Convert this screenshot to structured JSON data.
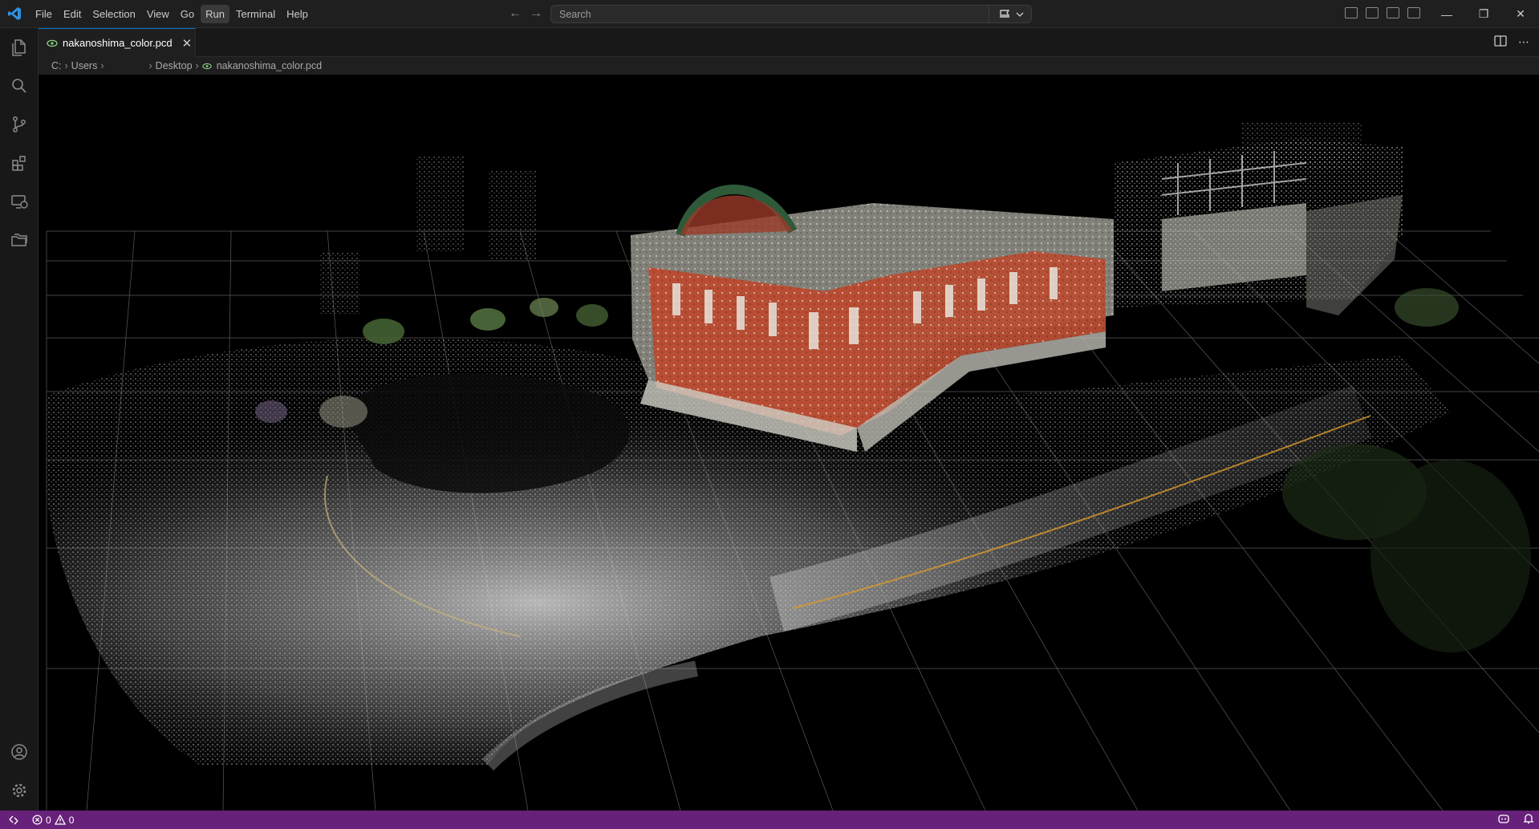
{
  "menu": [
    "File",
    "Edit",
    "Selection",
    "View",
    "Go",
    "Run",
    "Terminal",
    "Help"
  ],
  "search": {
    "placeholder": "Search"
  },
  "tab": {
    "filename": "nakanoshima_color.pcd"
  },
  "breadcrumb": {
    "drive": "C:",
    "users": "Users",
    "desktop": "Desktop",
    "file": "nakanoshima_color.pcd"
  },
  "status": {
    "errors": "0",
    "warnings": "0"
  },
  "colors": {
    "statusbar": "#68217a",
    "accent": "#0078d4",
    "background": "#1f1f1f",
    "brick": "#c4553a"
  },
  "icons": {
    "activity": [
      "explorer-icon",
      "search-icon",
      "source-control-icon",
      "extensions-icon",
      "remote-explorer-icon",
      "folders-icon",
      "account-icon",
      "settings-gear-icon"
    ]
  }
}
